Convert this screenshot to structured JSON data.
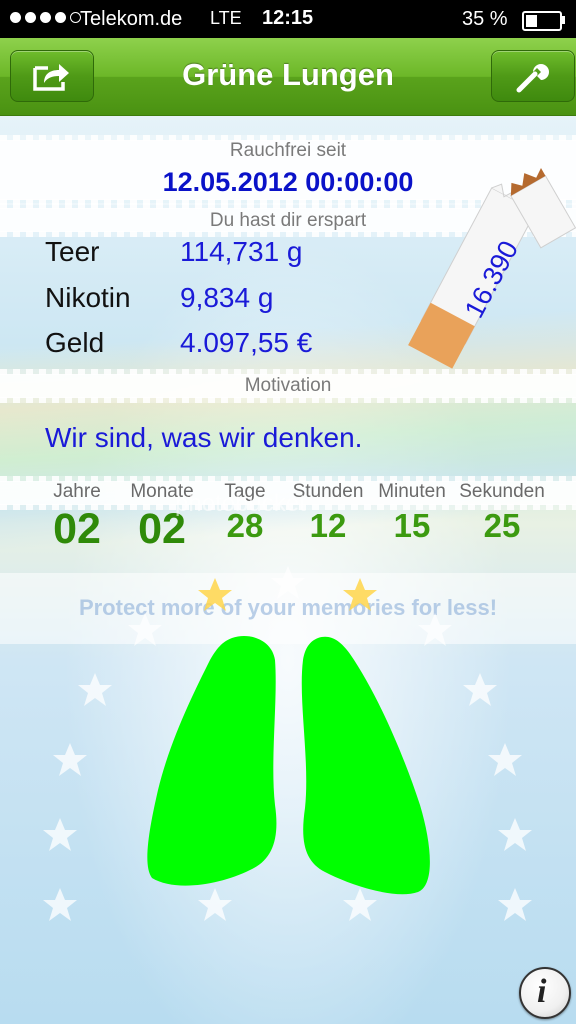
{
  "status_bar": {
    "carrier": "Telekom.de",
    "network": "LTE",
    "time": "12:15",
    "battery_text": "35 %",
    "battery_level": 0.35
  },
  "nav": {
    "title": "Grüne Lungen",
    "share_icon": "share-icon",
    "settings_icon": "wrench-icon"
  },
  "smoke_free": {
    "label": "Rauchfrei seit",
    "date": "12.05.2012 00:00:00"
  },
  "savings": {
    "label": "Du hast dir erspart",
    "rows": [
      {
        "label": "Teer",
        "value": "114,731 g"
      },
      {
        "label": "Nikotin",
        "value": "9,834 g"
      },
      {
        "label": "Geld",
        "value": "4.097,55 €"
      }
    ],
    "cigarette_count": "16.390"
  },
  "motivation": {
    "label": "Motivation",
    "quote": "Wir sind, was wir denken."
  },
  "duration": {
    "units": [
      {
        "label": "Jahre",
        "value": "02"
      },
      {
        "label": "Monate",
        "value": "02"
      },
      {
        "label": "Tage",
        "value": "28"
      },
      {
        "label": "Stunden",
        "value": "12"
      },
      {
        "label": "Minuten",
        "value": "15"
      },
      {
        "label": "Sekunden",
        "value": "25"
      }
    ]
  },
  "overlay": {
    "watermark": "photobucket",
    "ad_text": "Protect more of your memories for less!"
  },
  "colors": {
    "nav_green": "#6cb728",
    "lung_green": "#00ff00",
    "value_blue": "#1a1ad8",
    "counter_green": "#3c9a10"
  },
  "info_button": {
    "label": "i"
  }
}
